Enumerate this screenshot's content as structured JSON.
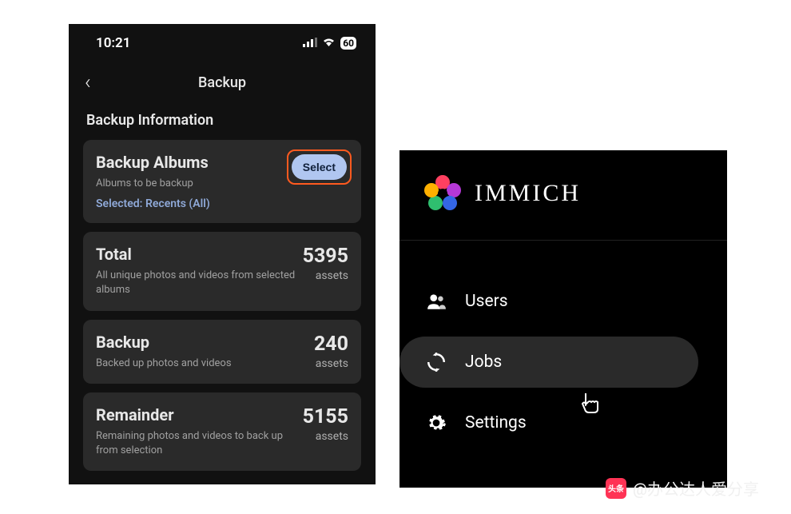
{
  "phone": {
    "status": {
      "time": "10:21",
      "battery": "60"
    },
    "nav_title": "Backup",
    "section_title": "Backup Information",
    "albums_card": {
      "heading": "Backup Albums",
      "sub": "Albums to be backup",
      "selected": "Selected: Recents (All)",
      "select_label": "Select"
    },
    "stats": [
      {
        "heading": "Total",
        "sub": "All unique photos and videos from selected albums",
        "value": "5395",
        "unit": "assets"
      },
      {
        "heading": "Backup",
        "sub": "Backed up photos and videos",
        "value": "240",
        "unit": "assets"
      },
      {
        "heading": "Remainder",
        "sub": "Remaining photos and videos to back up from selection",
        "value": "5155",
        "unit": "assets"
      }
    ]
  },
  "admin": {
    "brand": "IMMICH",
    "nav": [
      {
        "icon": "users",
        "label": "Users",
        "active": false
      },
      {
        "icon": "sync",
        "label": "Jobs",
        "active": true
      },
      {
        "icon": "gear",
        "label": "Settings",
        "active": false
      }
    ]
  },
  "watermark": {
    "prefix": "头条",
    "text": "@办公达人爱分享"
  }
}
